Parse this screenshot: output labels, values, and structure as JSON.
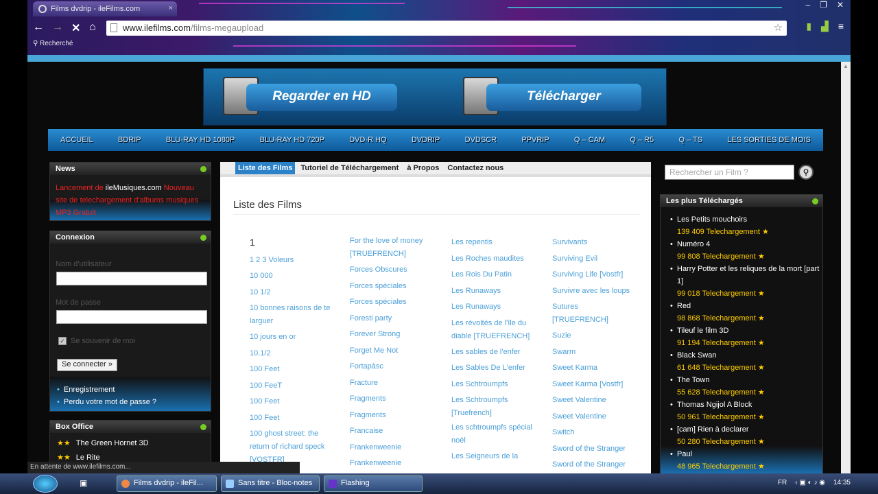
{
  "browser": {
    "tab_title": "Films dvdrip - ileFilms.com",
    "url_domain": "www.ilefilms.com",
    "url_path": "/films-megaupload",
    "bookmark": "Recherché"
  },
  "banner": {
    "watch_hd": "Regarder en HD",
    "download": "Télécharger"
  },
  "mainnav": [
    "ACCUEIL",
    "BDRIP",
    "BLU-RAY HD 1080P",
    "BLU-RAY HD 720P",
    "DVD-R HQ",
    "DVDRIP",
    "DVDSCR",
    "PPVRIP",
    "Q – CAM",
    "Q – R5",
    "Q – TS",
    "LES SORTIES DE MOIS"
  ],
  "news": {
    "title": "News",
    "text_a": "Lancement de ",
    "site": "ileMusiques.com",
    "text_b": " Nouveau site de telechargement d'albums musiques MP3 Gratuit"
  },
  "login": {
    "title": "Connexion",
    "user_label": "Nom d'utilisateur",
    "pass_label": "Mot de passe",
    "remember": "Se souvenir de moi",
    "button": "Se connecter »",
    "link_register": "Enregistrement",
    "link_lost": "Perdu votre mot de passe ?"
  },
  "boxoffice": {
    "title": "Box Office",
    "items": [
      "The Green Hornet 3D",
      "Le Rite"
    ]
  },
  "subnav": [
    "Liste des Films",
    "Tutoriel de Téléchargement",
    "à Propos",
    "Contactez nous"
  ],
  "list_title": "Liste des Films",
  "columns": {
    "c1_heading": "1",
    "c1": [
      "1 2 3 Voleurs",
      "10 000",
      "10 1/2",
      "10 bonnes raisons de te larguer",
      "10 jours en or",
      "10.1/2",
      "100 Feet",
      "100 FeeT",
      "100 Feet",
      "100 Feet",
      "100 ghost street: the return of richard speck [VOSTFR]"
    ],
    "c2": [
      "For the love of money [TRUEFRENCH]",
      "Forces Obscures",
      "Forces spéciales",
      "Forces spéciales",
      "Foresti party",
      "Forever Strong",
      "Forget Me Not",
      "Fortapàsc",
      "Fracture",
      "Fragments",
      "Fragments",
      "Francaise",
      "Frankenweenie",
      "Frankenweenie"
    ],
    "c3": [
      "Les repentis",
      "Les Roches maudites",
      "Les Rois Du Patin",
      "Les Runaways",
      "Les Runaways",
      "Les révoltés de l'île du diable [TRUEFRENCH]",
      "Les sables de l'enfer",
      "Les Sables De L'enfer",
      "Les Schtroumpfs",
      "Les Schtroumpfs [Truefrench]",
      "Les schtroumpfs spécial noël",
      "Les Seigneurs de la"
    ],
    "c4": [
      "Survivants",
      "Surviving Evil",
      "Surviving Life [Vostfr]",
      "Survivre avec les loups",
      "Sutures [TRUEFRENCH]",
      "Suzie",
      "Swarm",
      "Sweet Karma",
      "Sweet Karma [Vostfr]",
      "Sweet Valentine",
      "Sweet Valentine",
      "Switch",
      "Sword of the Stranger",
      "Sword of the Stranger"
    ]
  },
  "search": {
    "placeholder": "Rechercher un Film ?"
  },
  "top": {
    "title": "Les plus Téléchargés",
    "items": [
      {
        "name": "Les Petits mouchoirs",
        "count": "139 409 Telechargement ★"
      },
      {
        "name": "Numéro 4",
        "count": "99 808 Telechargement ★"
      },
      {
        "name": "Harry Potter et les reliques de la mort [part 1]",
        "count": "99 018 Telechargement ★"
      },
      {
        "name": "Red",
        "count": "98 868 Telechargement ★"
      },
      {
        "name": "Tileuf le film 3D",
        "count": "91 194 Telechargement ★"
      },
      {
        "name": "Black Swan",
        "count": "61 648 Telechargement ★"
      },
      {
        "name": "The Town",
        "count": "55 628 Telechargement ★"
      },
      {
        "name": "Thomas Ngijol A Block",
        "count": "50 961 Telechargement ★"
      },
      {
        "name": "[cam] Rien à declarer",
        "count": "50 280 Telechargement ★"
      },
      {
        "name": "Paul",
        "count": "48 965 Telechargement ★"
      }
    ]
  },
  "status": "En attente de www.ilefilms.com...",
  "taskbar": {
    "items": [
      "Films dvdrip - ileFil...",
      "Sans titre - Bloc-notes",
      "Flashing"
    ],
    "lang": "FR",
    "time": "14:35"
  }
}
